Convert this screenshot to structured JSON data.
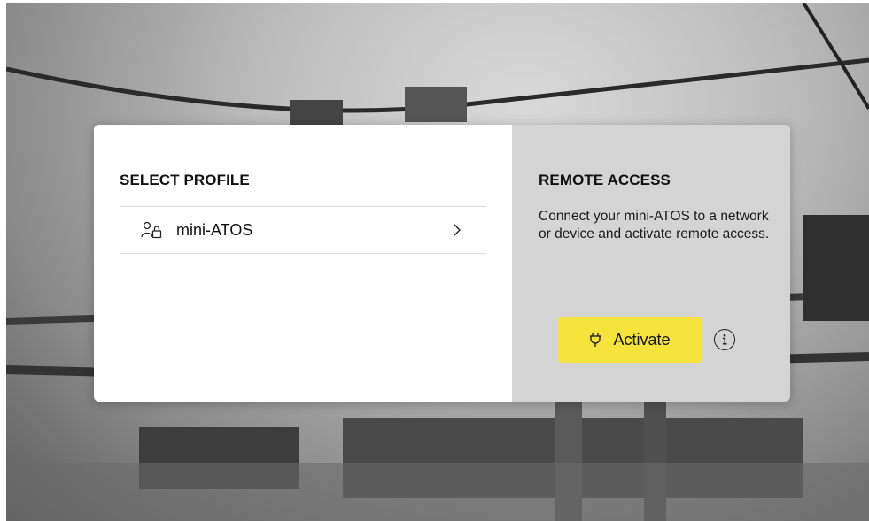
{
  "left_panel": {
    "title": "SELECT PROFILE",
    "profiles": [
      {
        "label": "mini-ATOS",
        "icon": "user-lock-icon",
        "trailing_icon": "chevron-right-icon"
      }
    ]
  },
  "right_panel": {
    "title": "REMOTE ACCESS",
    "description": "Connect your mini-ATOS to a network or device and activate remote access.",
    "activate_button": {
      "label": "Activate",
      "icon": "plug-icon"
    },
    "info_icon": "info-icon"
  },
  "colors": {
    "accent": "#f5e33c",
    "right_panel_bg": "#d4d4d4",
    "left_panel_bg": "#ffffff"
  }
}
